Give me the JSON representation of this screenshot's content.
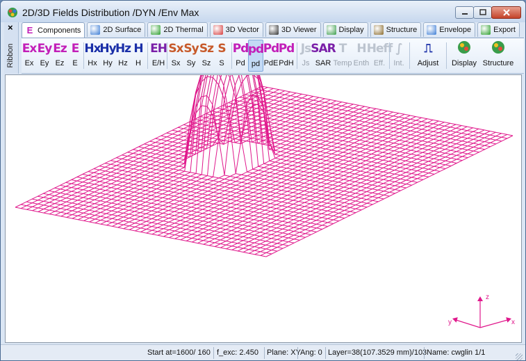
{
  "window": {
    "title": "2D/3D Fields Distribution /DYN /Env Max"
  },
  "ribbon": {
    "close_glyph": "×",
    "label": "Ribbon"
  },
  "tabs": [
    {
      "label": "Components",
      "icon": "E",
      "icon_color": "#c21fb8"
    },
    {
      "label": "2D Surface",
      "icon": "surface-icon",
      "icon_color": "#3a7bd5"
    },
    {
      "label": "2D Thermal",
      "icon": "thermal-icon",
      "icon_color": "#2a9d2a"
    },
    {
      "label": "3D Vector",
      "icon": "vector-icon",
      "icon_color": "#d63a3a"
    },
    {
      "label": "3D Viewer",
      "icon": "viewer-icon",
      "icon_color": "#333333"
    },
    {
      "label": "Display",
      "icon": "display-icon",
      "icon_color": "#3a9d4a"
    },
    {
      "label": "Structure",
      "icon": "structure-icon",
      "icon_color": "#8a6a2a"
    },
    {
      "label": "Envelope",
      "icon": "envelope-icon",
      "icon_color": "#3a7bd5"
    },
    {
      "label": "Export",
      "icon": "export-icon",
      "icon_color": "#2a9d2a"
    }
  ],
  "toolbar": [
    {
      "label": "Ex",
      "icon_text": "Ex",
      "color": "#c21fb8"
    },
    {
      "label": "Ey",
      "icon_text": "Ey",
      "color": "#c21fb8"
    },
    {
      "label": "Ez",
      "icon_text": "Ez",
      "color": "#c21fb8"
    },
    {
      "label": "E",
      "icon_text": "E",
      "color": "#c21fb8"
    },
    {
      "label": "Hx",
      "icon_text": "Hx",
      "color": "#1a2fa8"
    },
    {
      "label": "Hy",
      "icon_text": "Hy",
      "color": "#1a2fa8"
    },
    {
      "label": "Hz",
      "icon_text": "Hz",
      "color": "#1a2fa8"
    },
    {
      "label": "H",
      "icon_text": "H",
      "color": "#1a2fa8"
    },
    {
      "label": "E/H",
      "icon_text": "EH",
      "color": "#7a1fa8"
    },
    {
      "label": "Sx",
      "icon_text": "Sx",
      "color": "#c75a2a"
    },
    {
      "label": "Sy",
      "icon_text": "Sy",
      "color": "#c75a2a"
    },
    {
      "label": "Sz",
      "icon_text": "Sz",
      "color": "#c75a2a"
    },
    {
      "label": "S",
      "icon_text": "S",
      "color": "#c75a2a"
    },
    {
      "label": "Pd",
      "icon_text": "Pd",
      "color": "#c21fb8"
    },
    {
      "label": "pd",
      "icon_text": "pd",
      "color": "#c21fb8"
    },
    {
      "label": "PdE",
      "icon_text": "Pd",
      "color": "#c21fb8"
    },
    {
      "label": "PdH",
      "icon_text": "Pd",
      "color": "#c21fb8"
    },
    {
      "label": "Js",
      "icon_text": "Js",
      "color": "#999999"
    },
    {
      "label": "SAR",
      "icon_text": "SAR",
      "color": "#7a1fa8"
    },
    {
      "label": "Temp",
      "icon_text": "T",
      "color": "#999999"
    },
    {
      "label": "Enth",
      "icon_text": "H",
      "color": "#999999"
    },
    {
      "label": "Eff.",
      "icon_text": "Heff",
      "color": "#999999"
    },
    {
      "label": "Int.",
      "icon_text": "∫",
      "color": "#999999"
    },
    {
      "label": "Adjust",
      "icon_text": "⎍",
      "color": "#1a2fa8"
    },
    {
      "label": "Display",
      "icon_text": "display-icon",
      "color": "#3a9d4a"
    },
    {
      "label": "Structure",
      "icon_text": "structure-icon",
      "color": "#3a9d4a"
    }
  ],
  "axes": {
    "z": "z",
    "y": "y",
    "x": "x",
    "color": "#e0188c"
  },
  "mesh": {
    "color": "#e0188c",
    "hidden_color": "#b0b0b0",
    "grid_count": 44
  },
  "status": {
    "start": "Start at=1600/ 160",
    "fexc": "f_exc:  2.450",
    "plane": "Plane: XY",
    "ang": "Ang:   0",
    "layer": "Layer=38(107.3529 mm)/103",
    "name": "Name: cwglin 1/1"
  }
}
